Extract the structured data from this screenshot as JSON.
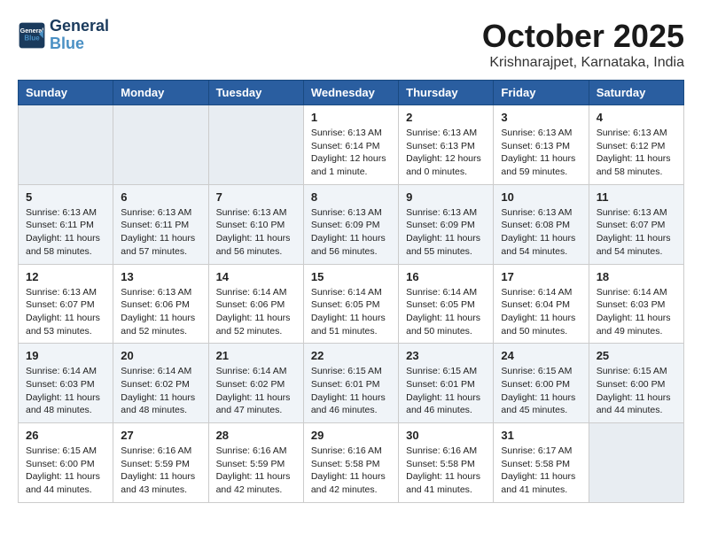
{
  "header": {
    "logo_line1": "General",
    "logo_line2": "Blue",
    "month_title": "October 2025",
    "location": "Krishnarajpet, Karnataka, India"
  },
  "weekdays": [
    "Sunday",
    "Monday",
    "Tuesday",
    "Wednesday",
    "Thursday",
    "Friday",
    "Saturday"
  ],
  "weeks": [
    [
      {
        "day": "",
        "info": ""
      },
      {
        "day": "",
        "info": ""
      },
      {
        "day": "",
        "info": ""
      },
      {
        "day": "1",
        "info": "Sunrise: 6:13 AM\nSunset: 6:14 PM\nDaylight: 12 hours\nand 1 minute."
      },
      {
        "day": "2",
        "info": "Sunrise: 6:13 AM\nSunset: 6:13 PM\nDaylight: 12 hours\nand 0 minutes."
      },
      {
        "day": "3",
        "info": "Sunrise: 6:13 AM\nSunset: 6:13 PM\nDaylight: 11 hours\nand 59 minutes."
      },
      {
        "day": "4",
        "info": "Sunrise: 6:13 AM\nSunset: 6:12 PM\nDaylight: 11 hours\nand 58 minutes."
      }
    ],
    [
      {
        "day": "5",
        "info": "Sunrise: 6:13 AM\nSunset: 6:11 PM\nDaylight: 11 hours\nand 58 minutes."
      },
      {
        "day": "6",
        "info": "Sunrise: 6:13 AM\nSunset: 6:11 PM\nDaylight: 11 hours\nand 57 minutes."
      },
      {
        "day": "7",
        "info": "Sunrise: 6:13 AM\nSunset: 6:10 PM\nDaylight: 11 hours\nand 56 minutes."
      },
      {
        "day": "8",
        "info": "Sunrise: 6:13 AM\nSunset: 6:09 PM\nDaylight: 11 hours\nand 56 minutes."
      },
      {
        "day": "9",
        "info": "Sunrise: 6:13 AM\nSunset: 6:09 PM\nDaylight: 11 hours\nand 55 minutes."
      },
      {
        "day": "10",
        "info": "Sunrise: 6:13 AM\nSunset: 6:08 PM\nDaylight: 11 hours\nand 54 minutes."
      },
      {
        "day": "11",
        "info": "Sunrise: 6:13 AM\nSunset: 6:07 PM\nDaylight: 11 hours\nand 54 minutes."
      }
    ],
    [
      {
        "day": "12",
        "info": "Sunrise: 6:13 AM\nSunset: 6:07 PM\nDaylight: 11 hours\nand 53 minutes."
      },
      {
        "day": "13",
        "info": "Sunrise: 6:13 AM\nSunset: 6:06 PM\nDaylight: 11 hours\nand 52 minutes."
      },
      {
        "day": "14",
        "info": "Sunrise: 6:14 AM\nSunset: 6:06 PM\nDaylight: 11 hours\nand 52 minutes."
      },
      {
        "day": "15",
        "info": "Sunrise: 6:14 AM\nSunset: 6:05 PM\nDaylight: 11 hours\nand 51 minutes."
      },
      {
        "day": "16",
        "info": "Sunrise: 6:14 AM\nSunset: 6:05 PM\nDaylight: 11 hours\nand 50 minutes."
      },
      {
        "day": "17",
        "info": "Sunrise: 6:14 AM\nSunset: 6:04 PM\nDaylight: 11 hours\nand 50 minutes."
      },
      {
        "day": "18",
        "info": "Sunrise: 6:14 AM\nSunset: 6:03 PM\nDaylight: 11 hours\nand 49 minutes."
      }
    ],
    [
      {
        "day": "19",
        "info": "Sunrise: 6:14 AM\nSunset: 6:03 PM\nDaylight: 11 hours\nand 48 minutes."
      },
      {
        "day": "20",
        "info": "Sunrise: 6:14 AM\nSunset: 6:02 PM\nDaylight: 11 hours\nand 48 minutes."
      },
      {
        "day": "21",
        "info": "Sunrise: 6:14 AM\nSunset: 6:02 PM\nDaylight: 11 hours\nand 47 minutes."
      },
      {
        "day": "22",
        "info": "Sunrise: 6:15 AM\nSunset: 6:01 PM\nDaylight: 11 hours\nand 46 minutes."
      },
      {
        "day": "23",
        "info": "Sunrise: 6:15 AM\nSunset: 6:01 PM\nDaylight: 11 hours\nand 46 minutes."
      },
      {
        "day": "24",
        "info": "Sunrise: 6:15 AM\nSunset: 6:00 PM\nDaylight: 11 hours\nand 45 minutes."
      },
      {
        "day": "25",
        "info": "Sunrise: 6:15 AM\nSunset: 6:00 PM\nDaylight: 11 hours\nand 44 minutes."
      }
    ],
    [
      {
        "day": "26",
        "info": "Sunrise: 6:15 AM\nSunset: 6:00 PM\nDaylight: 11 hours\nand 44 minutes."
      },
      {
        "day": "27",
        "info": "Sunrise: 6:16 AM\nSunset: 5:59 PM\nDaylight: 11 hours\nand 43 minutes."
      },
      {
        "day": "28",
        "info": "Sunrise: 6:16 AM\nSunset: 5:59 PM\nDaylight: 11 hours\nand 42 minutes."
      },
      {
        "day": "29",
        "info": "Sunrise: 6:16 AM\nSunset: 5:58 PM\nDaylight: 11 hours\nand 42 minutes."
      },
      {
        "day": "30",
        "info": "Sunrise: 6:16 AM\nSunset: 5:58 PM\nDaylight: 11 hours\nand 41 minutes."
      },
      {
        "day": "31",
        "info": "Sunrise: 6:17 AM\nSunset: 5:58 PM\nDaylight: 11 hours\nand 41 minutes."
      },
      {
        "day": "",
        "info": ""
      }
    ]
  ]
}
